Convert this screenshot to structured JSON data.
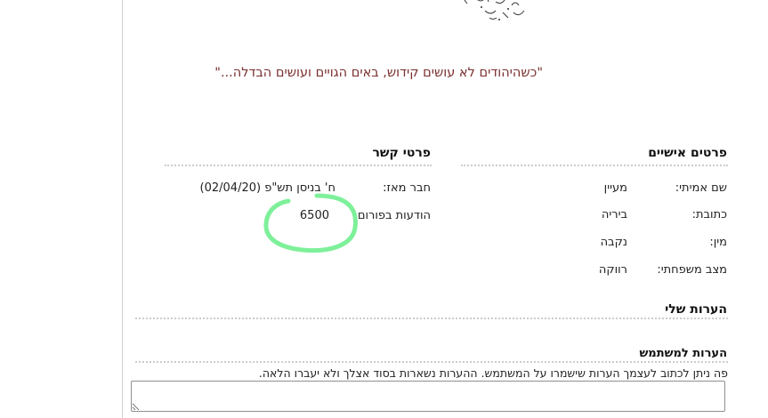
{
  "quote": "\"כשהיהודים לא עושים קידוש, באים הגויים ועושים הבדלה...\"",
  "personal": {
    "title": "פרטים אישיים",
    "rows": [
      {
        "label": "שם אמיתי:",
        "value": "מעיין"
      },
      {
        "label": "כתובת:",
        "value": "ביריה"
      },
      {
        "label": "מין:",
        "value": "נקבה"
      },
      {
        "label": "מצב משפחתי:",
        "value": "רווקה"
      }
    ]
  },
  "contact": {
    "title": "פרטי קשר",
    "rows": [
      {
        "label": "חבר מאז:",
        "value": "ח' בניסן תש\"פ (02/04/20)"
      },
      {
        "label": "הודעות בפורום",
        "value": "6500"
      }
    ]
  },
  "my_notes": {
    "title": "הערות שלי"
  },
  "user_notes": {
    "title": "הערות למשתמש",
    "description": "פה ניתן לכתוב לעצמך הערות שישמרו על המשתמש. ההערות נשארות בסוד אצלך ולא יעברו הלאה.",
    "value": ""
  },
  "colors": {
    "quote": "#7a2f2f",
    "highlight_circle": "#7ef09a"
  }
}
